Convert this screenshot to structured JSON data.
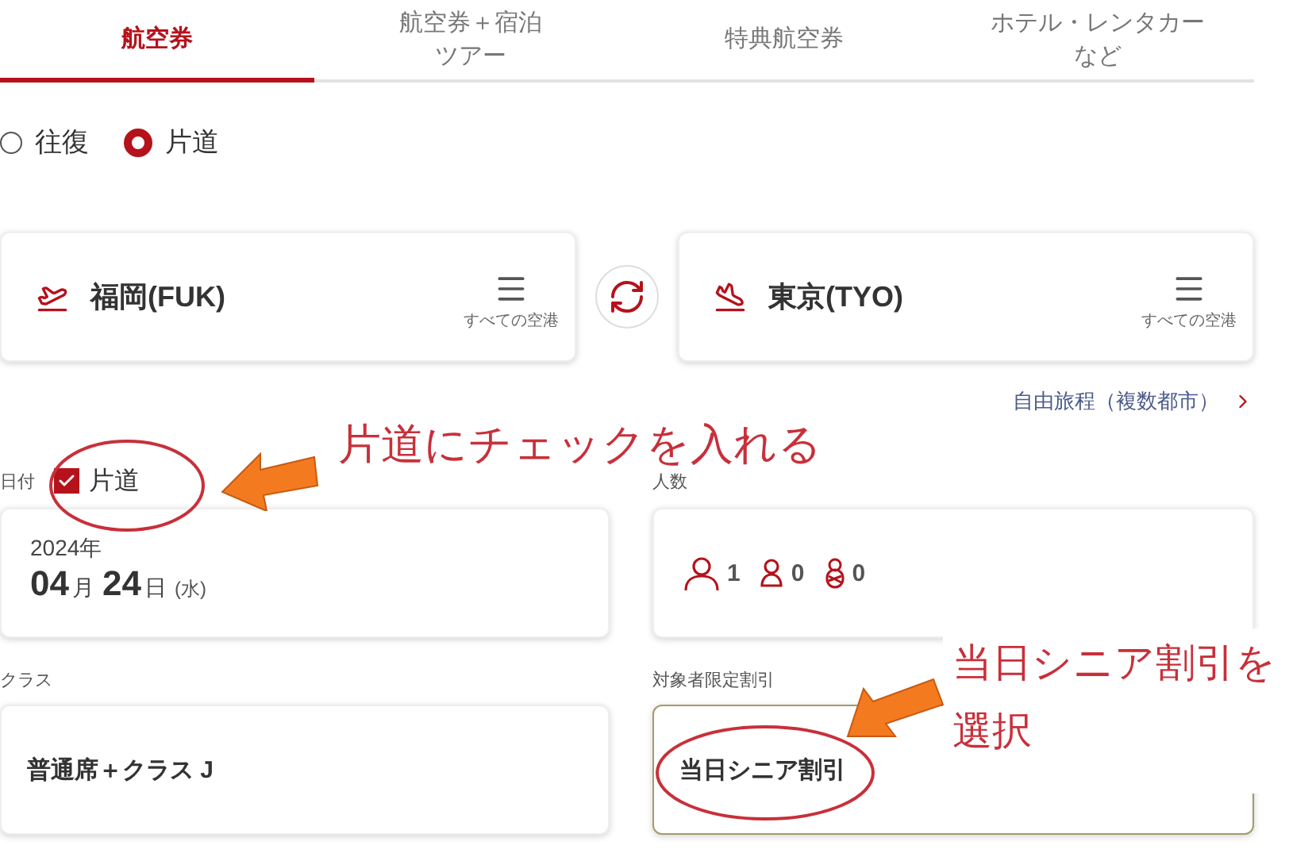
{
  "tabs": [
    {
      "lines": [
        "航空券"
      ],
      "selected": true
    },
    {
      "lines": [
        "航空券＋宿泊",
        "ツアー"
      ],
      "selected": false
    },
    {
      "lines": [
        "特典航空券"
      ],
      "selected": false
    },
    {
      "lines": [
        "ホテル・レンタカー",
        "など"
      ],
      "selected": false
    }
  ],
  "trip_type": [
    {
      "label": "往復",
      "selected": false
    },
    {
      "label": "片道",
      "selected": true
    }
  ],
  "origin": {
    "name": "福岡(FUK)",
    "airports_label": "すべての空港"
  },
  "destination": {
    "name": "東京(TYO)",
    "airports_label": "すべての空港"
  },
  "multi_city_link": "自由旅程（複数都市）",
  "date": {
    "label": "日付",
    "one_way": {
      "label": "片道",
      "checked": true
    },
    "year": "2024年",
    "month": "04",
    "month_unit": "月",
    "day": "24",
    "day_unit": "日",
    "weekday": "(水)"
  },
  "passengers": {
    "label": "人数",
    "counts": [
      {
        "kind": "adult",
        "count": "1"
      },
      {
        "kind": "child",
        "count": "0"
      },
      {
        "kind": "infant",
        "count": "0"
      }
    ]
  },
  "seat_class": {
    "label": "クラス",
    "value": "普通席＋クラス J"
  },
  "discount": {
    "label": "対象者限定割引",
    "value": "当日シニア割引"
  },
  "annotations": {
    "checkbox_note": "片道にチェックを入れる",
    "discount_note": [
      "当日シニア割引を",
      "選択"
    ]
  }
}
